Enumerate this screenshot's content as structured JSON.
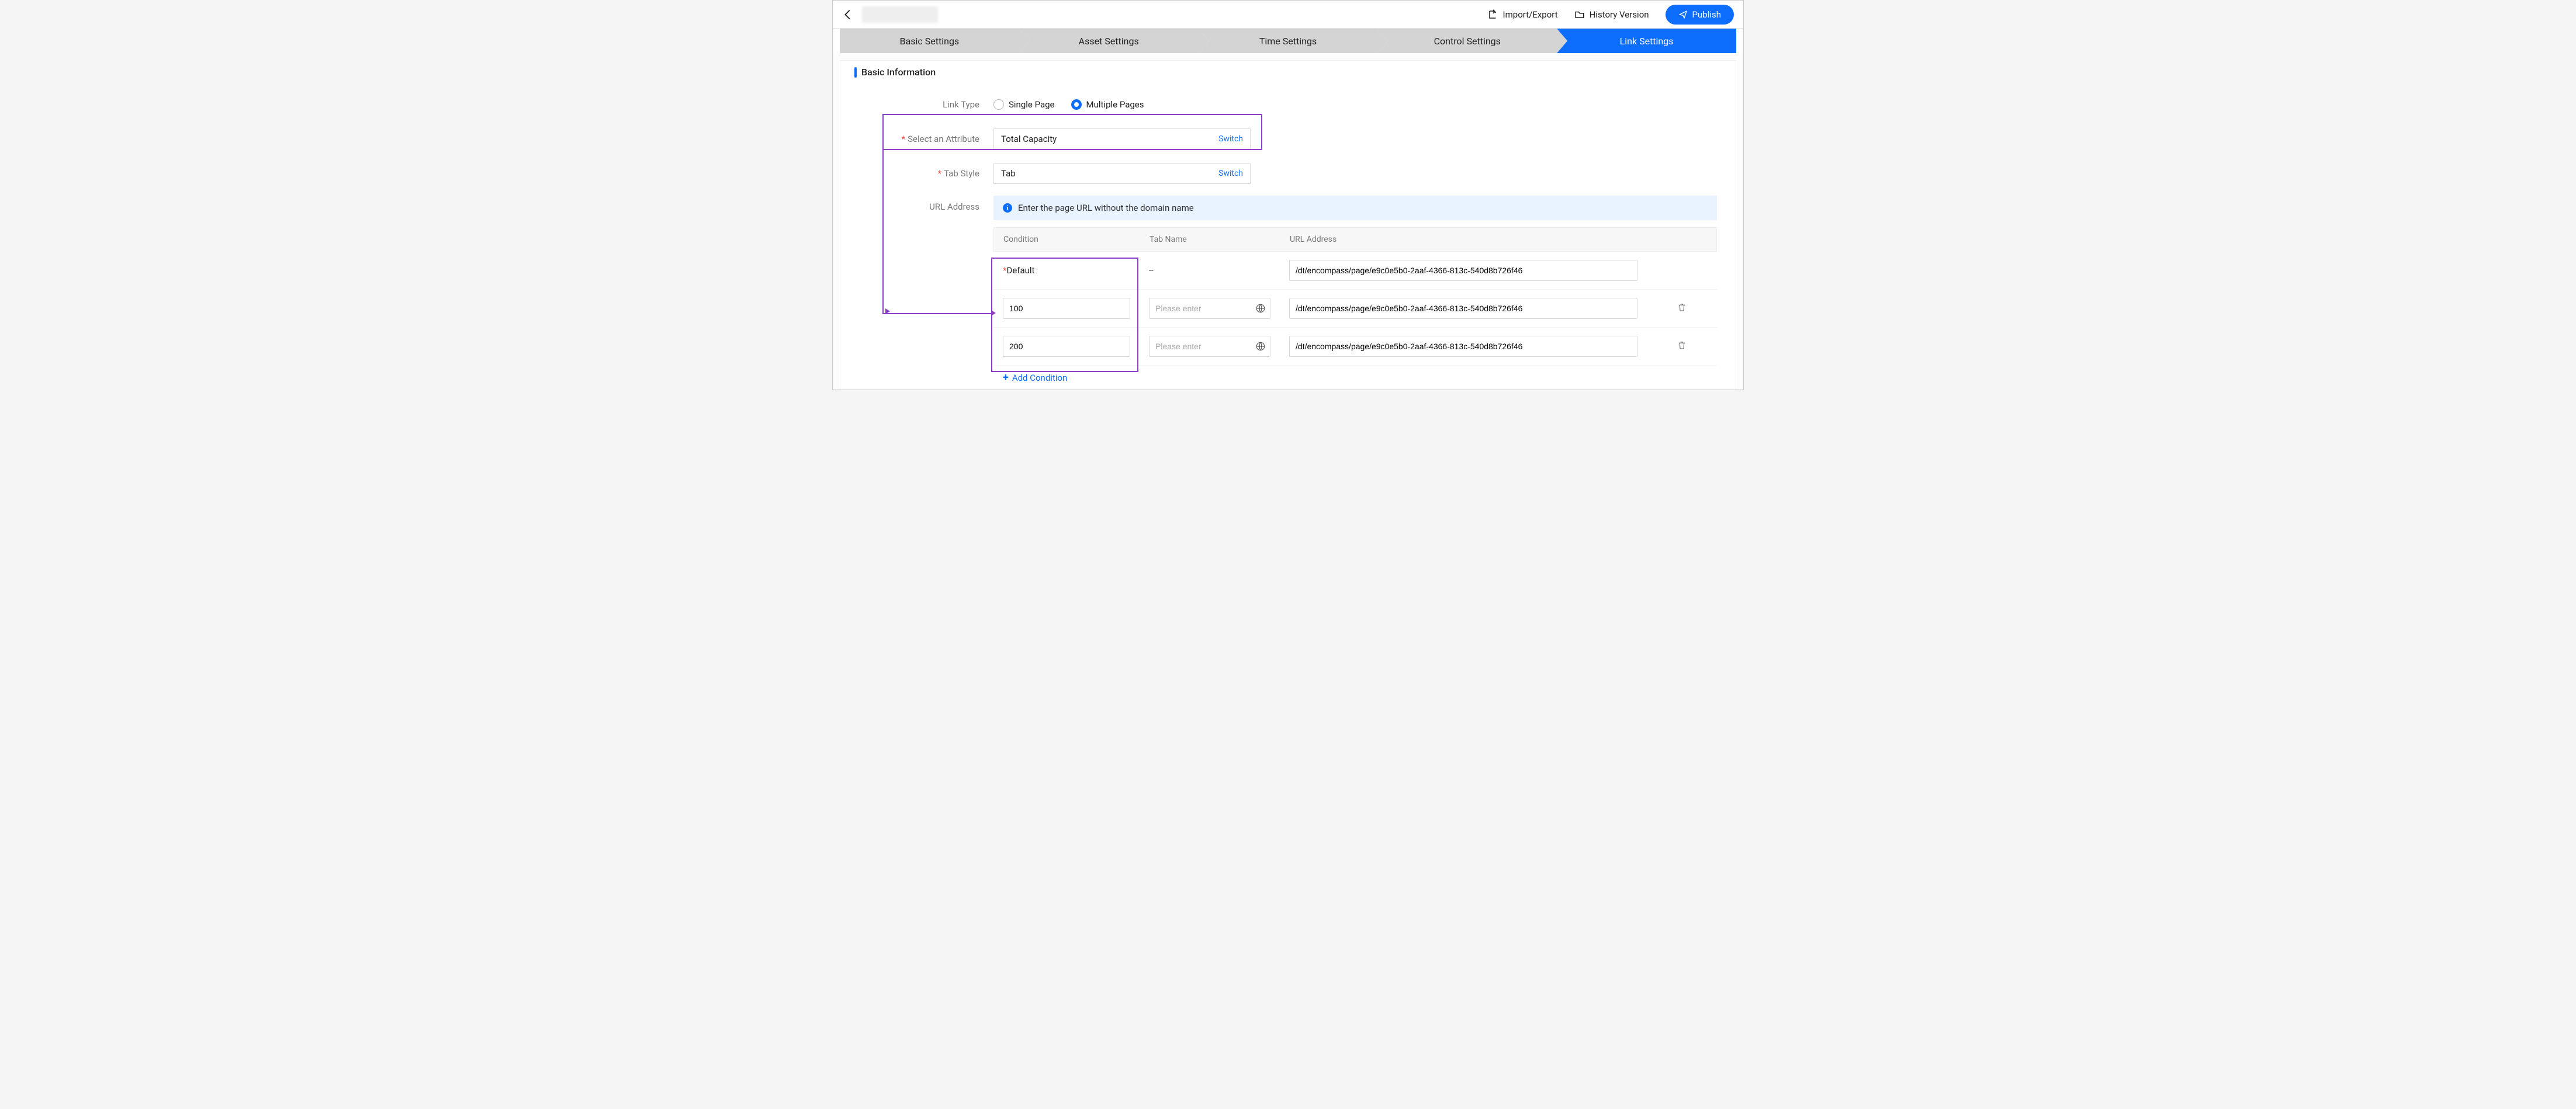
{
  "topbar": {
    "import_export": "Import/Export",
    "history_version": "History Version",
    "publish": "Publish"
  },
  "steps": [
    "Basic Settings",
    "Asset Settings",
    "Time Settings",
    "Control Settings",
    "Link Settings"
  ],
  "active_step": 4,
  "section_title": "Basic Information",
  "form": {
    "link_type_label": "Link Type",
    "link_type_options": {
      "single": "Single Page",
      "multiple": "Multiple Pages"
    },
    "link_type_selected": "multiple",
    "select_attr_label": "Select an Attribute",
    "select_attr_value": "Total Capacity",
    "switch_label": "Switch",
    "tab_style_label": "Tab Style",
    "tab_style_value": "Tab",
    "url_label": "URL Address"
  },
  "info_text": "Enter the page URL without the domain name",
  "table": {
    "headers": {
      "condition": "Condition",
      "tab_name": "Tab Name",
      "url": "URL Address"
    },
    "default_label": "Default",
    "default_tab": "--",
    "default_url": "/dt/encompass/page/e9c0e5b0-2aaf-4366-813c-540d8b726f46",
    "tab_placeholder": "Please enter",
    "rows": [
      {
        "condition": "100",
        "tab": "",
        "url": "/dt/encompass/page/e9c0e5b0-2aaf-4366-813c-540d8b726f46"
      },
      {
        "condition": "200",
        "tab": "",
        "url": "/dt/encompass/page/e9c0e5b0-2aaf-4366-813c-540d8b726f46"
      }
    ],
    "add_condition": "Add Condition"
  }
}
